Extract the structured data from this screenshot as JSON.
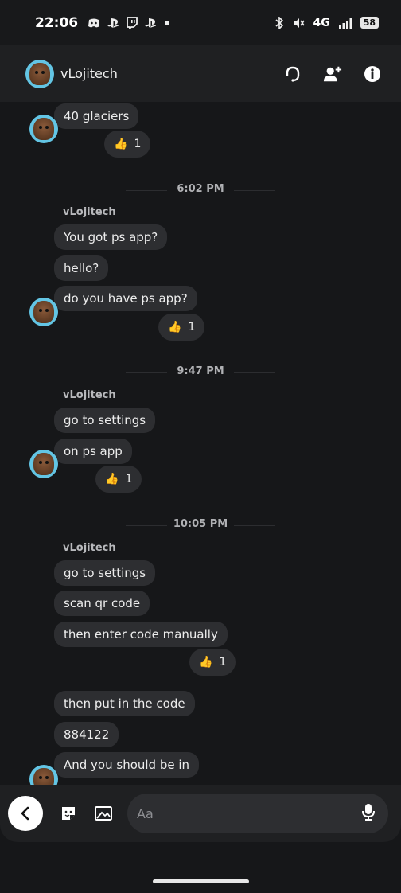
{
  "status_bar": {
    "time": "22:06",
    "network": "4G",
    "battery": "58",
    "left_icons": [
      "discord-icon",
      "playstation-icon",
      "twitch-icon",
      "playstation-icon",
      "dot-icon"
    ],
    "right_icons": [
      "bluetooth-icon",
      "mute-icon",
      "signal-icon",
      "battery-icon"
    ]
  },
  "header": {
    "contact_name": "vLojitech",
    "actions": [
      "headset-icon",
      "add-friend-icon",
      "info-icon"
    ]
  },
  "messages": {
    "m0": "40 glaciers",
    "r0": "1",
    "ts1": "6:02 PM",
    "sender1": "vLojitech",
    "m1": "You got ps app?",
    "m2": "hello?",
    "m3": "do you have ps app?",
    "r3": "1",
    "ts2": "9:47 PM",
    "sender2": "vLojitech",
    "m4": "go to settings",
    "m5": "on ps app",
    "r5": "1",
    "ts3": "10:05 PM",
    "sender3": "vLojitech",
    "m6": "go to settings",
    "m7": "scan qr code",
    "m8": "then enter code manually",
    "r8": "1",
    "m9": "then put in the code",
    "m10": "884122",
    "m11": "And you should be in"
  },
  "composer": {
    "placeholder": "Aa"
  },
  "colors": {
    "background": "#161719",
    "bubble": "#2d2e31",
    "avatar_ring": "#63c5e4"
  }
}
